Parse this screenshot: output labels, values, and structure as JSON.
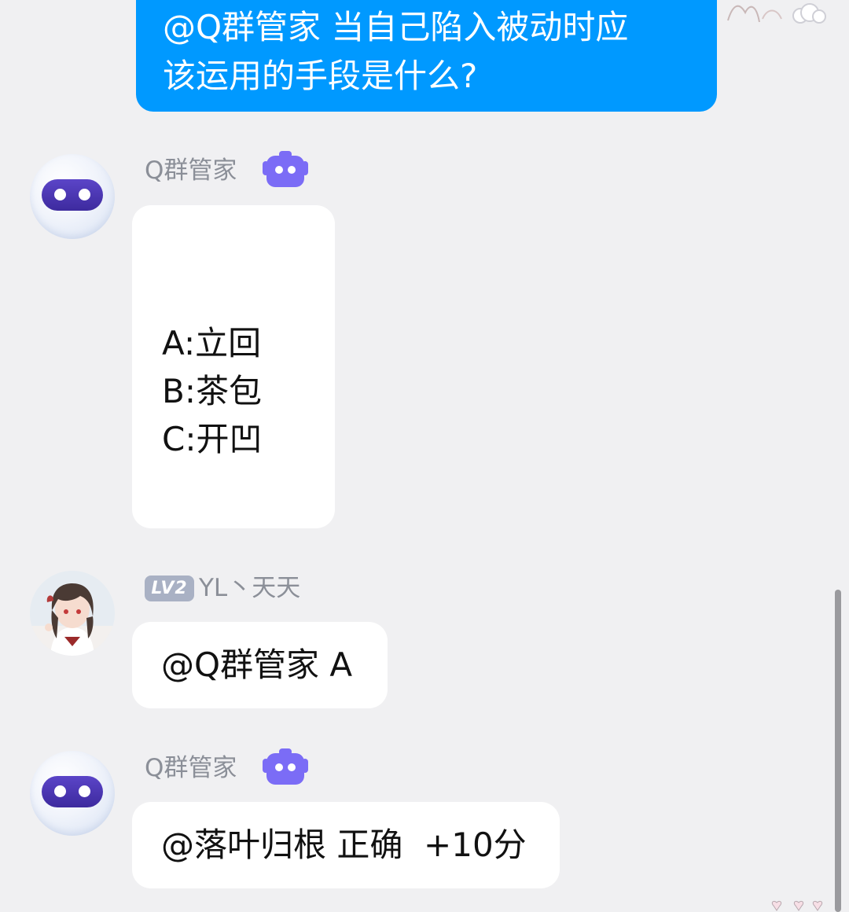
{
  "messages": {
    "outgoing_question": {
      "line1": "@Q群管家 当自己陷入被动时应",
      "line2": "该运用的手段是什么?"
    },
    "bot_quiz": {
      "sender": "Q群管家",
      "options": [
        "A:立回",
        "B:茶包",
        "C:开凹"
      ]
    },
    "user_answer": {
      "level_badge": "LV2",
      "sender": "YL丶天天",
      "text": "@Q群管家 A"
    },
    "bot_result": {
      "sender": "Q群管家",
      "text": "@落叶归根 正确  +10分"
    }
  },
  "icons": {
    "bot_avatar": "robot-avatar-icon",
    "bot_badge": "robot-badge-icon",
    "user_avatar": "anime-girl-avatar",
    "decoration": "hearts-sticker-icon"
  },
  "colors": {
    "outgoing_bubble": "#0099ff",
    "incoming_bubble": "#ffffff",
    "background": "#f0f0f2",
    "bot_badge": "#7b6cf6",
    "level_badge": "#a9b1c4",
    "name_text": "#8b8f98"
  }
}
